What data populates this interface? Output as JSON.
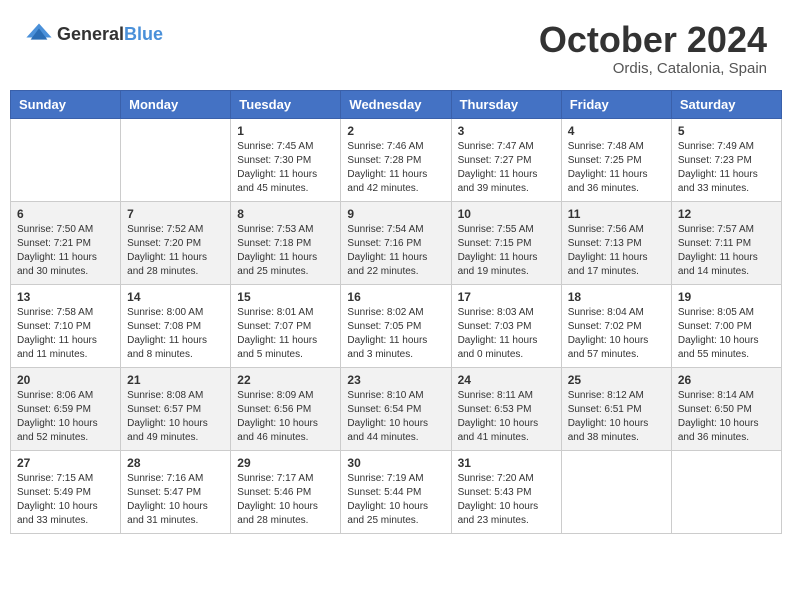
{
  "header": {
    "logo": {
      "general": "General",
      "blue": "Blue"
    },
    "month": "October 2024",
    "location": "Ordis, Catalonia, Spain"
  },
  "days_of_week": [
    "Sunday",
    "Monday",
    "Tuesday",
    "Wednesday",
    "Thursday",
    "Friday",
    "Saturday"
  ],
  "weeks": [
    [
      null,
      null,
      {
        "day": "1",
        "sunrise": "Sunrise: 7:45 AM",
        "sunset": "Sunset: 7:30 PM",
        "daylight": "Daylight: 11 hours and 45 minutes."
      },
      {
        "day": "2",
        "sunrise": "Sunrise: 7:46 AM",
        "sunset": "Sunset: 7:28 PM",
        "daylight": "Daylight: 11 hours and 42 minutes."
      },
      {
        "day": "3",
        "sunrise": "Sunrise: 7:47 AM",
        "sunset": "Sunset: 7:27 PM",
        "daylight": "Daylight: 11 hours and 39 minutes."
      },
      {
        "day": "4",
        "sunrise": "Sunrise: 7:48 AM",
        "sunset": "Sunset: 7:25 PM",
        "daylight": "Daylight: 11 hours and 36 minutes."
      },
      {
        "day": "5",
        "sunrise": "Sunrise: 7:49 AM",
        "sunset": "Sunset: 7:23 PM",
        "daylight": "Daylight: 11 hours and 33 minutes."
      }
    ],
    [
      {
        "day": "6",
        "sunrise": "Sunrise: 7:50 AM",
        "sunset": "Sunset: 7:21 PM",
        "daylight": "Daylight: 11 hours and 30 minutes."
      },
      {
        "day": "7",
        "sunrise": "Sunrise: 7:52 AM",
        "sunset": "Sunset: 7:20 PM",
        "daylight": "Daylight: 11 hours and 28 minutes."
      },
      {
        "day": "8",
        "sunrise": "Sunrise: 7:53 AM",
        "sunset": "Sunset: 7:18 PM",
        "daylight": "Daylight: 11 hours and 25 minutes."
      },
      {
        "day": "9",
        "sunrise": "Sunrise: 7:54 AM",
        "sunset": "Sunset: 7:16 PM",
        "daylight": "Daylight: 11 hours and 22 minutes."
      },
      {
        "day": "10",
        "sunrise": "Sunrise: 7:55 AM",
        "sunset": "Sunset: 7:15 PM",
        "daylight": "Daylight: 11 hours and 19 minutes."
      },
      {
        "day": "11",
        "sunrise": "Sunrise: 7:56 AM",
        "sunset": "Sunset: 7:13 PM",
        "daylight": "Daylight: 11 hours and 17 minutes."
      },
      {
        "day": "12",
        "sunrise": "Sunrise: 7:57 AM",
        "sunset": "Sunset: 7:11 PM",
        "daylight": "Daylight: 11 hours and 14 minutes."
      }
    ],
    [
      {
        "day": "13",
        "sunrise": "Sunrise: 7:58 AM",
        "sunset": "Sunset: 7:10 PM",
        "daylight": "Daylight: 11 hours and 11 minutes."
      },
      {
        "day": "14",
        "sunrise": "Sunrise: 8:00 AM",
        "sunset": "Sunset: 7:08 PM",
        "daylight": "Daylight: 11 hours and 8 minutes."
      },
      {
        "day": "15",
        "sunrise": "Sunrise: 8:01 AM",
        "sunset": "Sunset: 7:07 PM",
        "daylight": "Daylight: 11 hours and 5 minutes."
      },
      {
        "day": "16",
        "sunrise": "Sunrise: 8:02 AM",
        "sunset": "Sunset: 7:05 PM",
        "daylight": "Daylight: 11 hours and 3 minutes."
      },
      {
        "day": "17",
        "sunrise": "Sunrise: 8:03 AM",
        "sunset": "Sunset: 7:03 PM",
        "daylight": "Daylight: 11 hours and 0 minutes."
      },
      {
        "day": "18",
        "sunrise": "Sunrise: 8:04 AM",
        "sunset": "Sunset: 7:02 PM",
        "daylight": "Daylight: 10 hours and 57 minutes."
      },
      {
        "day": "19",
        "sunrise": "Sunrise: 8:05 AM",
        "sunset": "Sunset: 7:00 PM",
        "daylight": "Daylight: 10 hours and 55 minutes."
      }
    ],
    [
      {
        "day": "20",
        "sunrise": "Sunrise: 8:06 AM",
        "sunset": "Sunset: 6:59 PM",
        "daylight": "Daylight: 10 hours and 52 minutes."
      },
      {
        "day": "21",
        "sunrise": "Sunrise: 8:08 AM",
        "sunset": "Sunset: 6:57 PM",
        "daylight": "Daylight: 10 hours and 49 minutes."
      },
      {
        "day": "22",
        "sunrise": "Sunrise: 8:09 AM",
        "sunset": "Sunset: 6:56 PM",
        "daylight": "Daylight: 10 hours and 46 minutes."
      },
      {
        "day": "23",
        "sunrise": "Sunrise: 8:10 AM",
        "sunset": "Sunset: 6:54 PM",
        "daylight": "Daylight: 10 hours and 44 minutes."
      },
      {
        "day": "24",
        "sunrise": "Sunrise: 8:11 AM",
        "sunset": "Sunset: 6:53 PM",
        "daylight": "Daylight: 10 hours and 41 minutes."
      },
      {
        "day": "25",
        "sunrise": "Sunrise: 8:12 AM",
        "sunset": "Sunset: 6:51 PM",
        "daylight": "Daylight: 10 hours and 38 minutes."
      },
      {
        "day": "26",
        "sunrise": "Sunrise: 8:14 AM",
        "sunset": "Sunset: 6:50 PM",
        "daylight": "Daylight: 10 hours and 36 minutes."
      }
    ],
    [
      {
        "day": "27",
        "sunrise": "Sunrise: 7:15 AM",
        "sunset": "Sunset: 5:49 PM",
        "daylight": "Daylight: 10 hours and 33 minutes."
      },
      {
        "day": "28",
        "sunrise": "Sunrise: 7:16 AM",
        "sunset": "Sunset: 5:47 PM",
        "daylight": "Daylight: 10 hours and 31 minutes."
      },
      {
        "day": "29",
        "sunrise": "Sunrise: 7:17 AM",
        "sunset": "Sunset: 5:46 PM",
        "daylight": "Daylight: 10 hours and 28 minutes."
      },
      {
        "day": "30",
        "sunrise": "Sunrise: 7:19 AM",
        "sunset": "Sunset: 5:44 PM",
        "daylight": "Daylight: 10 hours and 25 minutes."
      },
      {
        "day": "31",
        "sunrise": "Sunrise: 7:20 AM",
        "sunset": "Sunset: 5:43 PM",
        "daylight": "Daylight: 10 hours and 23 minutes."
      },
      null,
      null
    ]
  ]
}
